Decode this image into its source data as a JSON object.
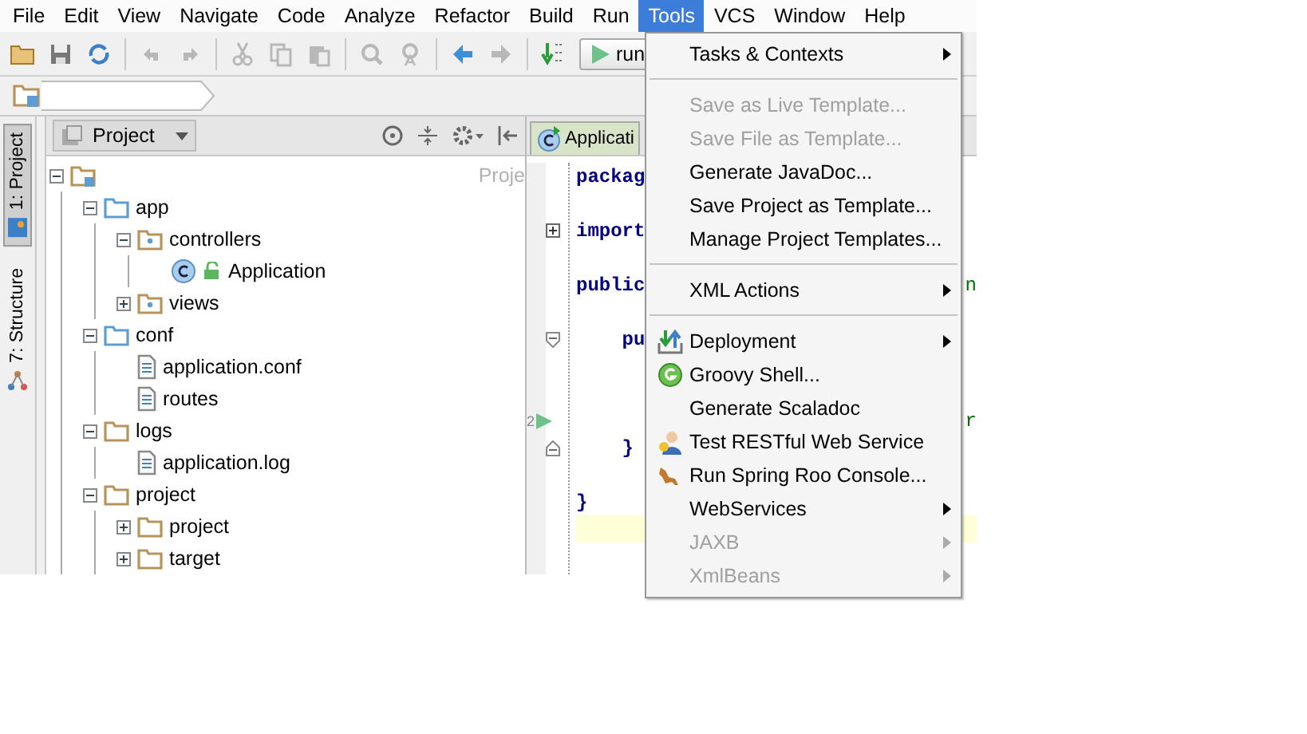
{
  "menubar": [
    {
      "label": "File",
      "selected": false
    },
    {
      "label": "Edit",
      "selected": false
    },
    {
      "label": "View",
      "selected": false
    },
    {
      "label": "Navigate",
      "selected": false
    },
    {
      "label": "Code",
      "selected": false
    },
    {
      "label": "Analyze",
      "selected": false
    },
    {
      "label": "Refactor",
      "selected": false
    },
    {
      "label": "Build",
      "selected": false
    },
    {
      "label": "Run",
      "selected": false
    },
    {
      "label": "Tools",
      "selected": true
    },
    {
      "label": "VCS",
      "selected": false
    },
    {
      "label": "Window",
      "selected": false
    },
    {
      "label": "Help",
      "selected": false
    }
  ],
  "toolbar": {
    "run_button": "run"
  },
  "side_tabs": [
    {
      "label": "1: Project",
      "selected": true
    },
    {
      "label": "7: Structure",
      "selected": false
    }
  ],
  "project_panel": {
    "view_selector": "Project",
    "root_hint": "Proje",
    "tree": [
      {
        "label": "app",
        "kind": "source-folder",
        "expanded": true,
        "children": [
          {
            "label": "controllers",
            "kind": "package",
            "expanded": true,
            "children": [
              {
                "label": "Application",
                "kind": "class"
              }
            ]
          },
          {
            "label": "views",
            "kind": "package",
            "expanded": false
          }
        ]
      },
      {
        "label": "conf",
        "kind": "source-folder",
        "expanded": true,
        "children": [
          {
            "label": "application.conf",
            "kind": "file"
          },
          {
            "label": "routes",
            "kind": "file"
          }
        ]
      },
      {
        "label": "logs",
        "kind": "folder",
        "expanded": true,
        "children": [
          {
            "label": "application.log",
            "kind": "file"
          }
        ]
      },
      {
        "label": "project",
        "kind": "folder",
        "expanded": true,
        "children": [
          {
            "label": "project",
            "kind": "folder",
            "expanded": false
          },
          {
            "label": "target",
            "kind": "folder",
            "expanded": false
          }
        ]
      }
    ]
  },
  "editor": {
    "tab": "Applicati",
    "lines": [
      {
        "kind": "code",
        "text": "packag",
        "current": false
      },
      {
        "kind": "code",
        "current": false
      },
      {
        "kind": "folded",
        "text": "import",
        "current": false
      },
      {
        "kind": "code",
        "current": false
      },
      {
        "kind": "code",
        "text": "public",
        "right": "n",
        "current": false
      },
      {
        "kind": "code",
        "current": false
      },
      {
        "kind": "fold-start",
        "text": "    pu",
        "current": false
      },
      {
        "kind": "code",
        "current": false
      },
      {
        "kind": "code",
        "current": false
      },
      {
        "kind": "code",
        "right": "r",
        "run_marker": "2",
        "current": false
      },
      {
        "kind": "fold-end",
        "text": "    }",
        "current": false
      },
      {
        "kind": "code",
        "current": false
      },
      {
        "kind": "code",
        "text": "}",
        "current": false
      },
      {
        "kind": "code",
        "current": true
      }
    ]
  },
  "tools_menu": [
    {
      "kind": "item",
      "label": "Tasks & Contexts",
      "disabled": false,
      "submenu": true
    },
    {
      "kind": "separator"
    },
    {
      "kind": "item",
      "label": "Save as Live Template...",
      "disabled": true,
      "submenu": false
    },
    {
      "kind": "item",
      "label": "Save File as Template...",
      "disabled": true,
      "submenu": false
    },
    {
      "kind": "item",
      "label": "Generate JavaDoc...",
      "disabled": false,
      "submenu": false
    },
    {
      "kind": "item",
      "label": "Save Project as Template...",
      "disabled": false,
      "submenu": false
    },
    {
      "kind": "item",
      "label": "Manage Project Templates...",
      "disabled": false,
      "submenu": false
    },
    {
      "kind": "separator"
    },
    {
      "kind": "item",
      "label": "XML Actions",
      "disabled": false,
      "submenu": true
    },
    {
      "kind": "separator"
    },
    {
      "kind": "deploy",
      "label": "Deployment",
      "disabled": false,
      "submenu": true
    },
    {
      "kind": "groovy",
      "label": "Groovy Shell...",
      "disabled": false,
      "submenu": false
    },
    {
      "kind": "item",
      "label": "Generate Scaladoc",
      "disabled": false,
      "submenu": false
    },
    {
      "kind": "tester",
      "label": "Test RESTful Web Service",
      "disabled": false,
      "submenu": false
    },
    {
      "kind": "kangaroo",
      "label": "Run Spring Roo Console...",
      "disabled": false,
      "submenu": false
    },
    {
      "kind": "item",
      "label": "WebServices",
      "disabled": false,
      "submenu": true
    },
    {
      "kind": "item",
      "label": "JAXB",
      "disabled": true,
      "submenu": true
    },
    {
      "kind": "item",
      "label": "XmlBeans",
      "disabled": true,
      "submenu": true
    }
  ]
}
